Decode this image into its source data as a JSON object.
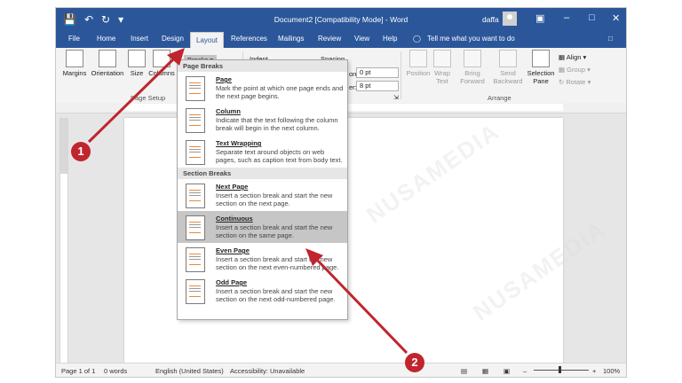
{
  "window": {
    "title": "Document2 [Compatibility Mode] - Word",
    "user": "daffa"
  },
  "tabs": [
    "File",
    "Home",
    "Insert",
    "Design",
    "Layout",
    "References",
    "Mailings",
    "Review",
    "View",
    "Help"
  ],
  "tell_me": "Tell me what you want to do",
  "ribbon": {
    "margins": "Margins",
    "orientation": "Orientation",
    "size": "Size",
    "columns": "Columns",
    "breaks": "Breaks",
    "indent": "Indent",
    "spacing": "Spacing",
    "before_label": "ore:",
    "before_value": "0 pt",
    "after_label": "er:",
    "after_value": "8 pt",
    "page_setup_label": "Page Setup",
    "arrange_label": "Arrange",
    "position": "Position",
    "wrap_text": "Wrap Text",
    "bring_forward": "Bring Forward",
    "send_backward": "Send Backward",
    "selection_pane": "Selection Pane",
    "align": "Align",
    "group": "Group",
    "rotate": "Rotate"
  },
  "breaks_menu": {
    "page_breaks_header": "Page Breaks",
    "section_breaks_header": "Section Breaks",
    "items": [
      {
        "title": "Page",
        "desc": "Mark the point at which one page ends and the next page begins."
      },
      {
        "title": "Column",
        "desc": "Indicate that the text following the column break will begin in the next column."
      },
      {
        "title": "Text Wrapping",
        "desc": "Separate text around objects on web pages, such as caption text from body text."
      },
      {
        "title": "Next Page",
        "desc": "Insert a section break and start the new section on the next page."
      },
      {
        "title": "Continuous",
        "desc": "Insert a section break and start the new section on the same page."
      },
      {
        "title": "Even Page",
        "desc": "Insert a section break and start the new section on the next even-numbered page."
      },
      {
        "title": "Odd Page",
        "desc": "Insert a section break and start the new section on the next odd-numbered page."
      }
    ]
  },
  "status": {
    "page": "Page 1 of 1",
    "words": "0 words",
    "language": "English (United States)",
    "accessibility": "Accessibility: Unavailable",
    "zoom": "100%"
  },
  "callouts": [
    "1",
    "2"
  ],
  "watermark": "NUSAMEDIA",
  "colors": {
    "title_bar": "#2b579a",
    "highlight": "#c6c6c6",
    "callout_red": "#c0252d"
  }
}
